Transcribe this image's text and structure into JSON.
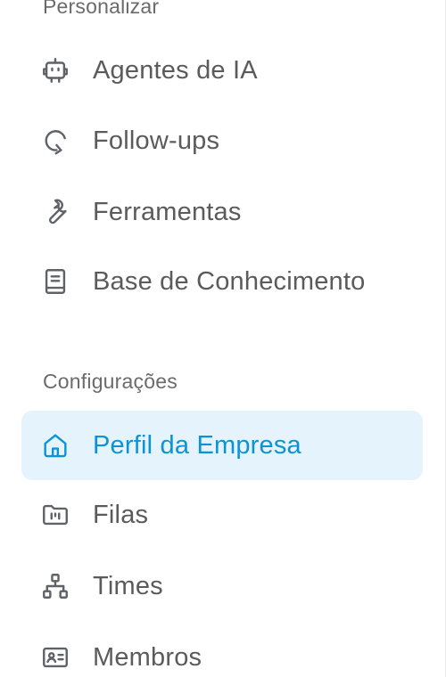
{
  "sections": [
    {
      "title": "Personalizar",
      "items": [
        {
          "label": "Agentes de IA",
          "icon": "robot-icon"
        },
        {
          "label": "Follow-ups",
          "icon": "refresh-arrow-icon"
        },
        {
          "label": "Ferramentas",
          "icon": "wrench-icon"
        },
        {
          "label": "Base de Conhecimento",
          "icon": "book-icon"
        }
      ]
    },
    {
      "title": "Configurações",
      "items": [
        {
          "label": "Perfil da Empresa",
          "icon": "home-icon",
          "active": true
        },
        {
          "label": "Filas",
          "icon": "folder-icon"
        },
        {
          "label": "Times",
          "icon": "org-chart-icon"
        },
        {
          "label": "Membros",
          "icon": "id-card-icon"
        }
      ]
    }
  ],
  "colors": {
    "accent": "#0b93d6",
    "active_background": "#e5f4fc",
    "text": "#5b5b5b",
    "section_title": "#6b6b6b",
    "icon": "#5f6368"
  }
}
